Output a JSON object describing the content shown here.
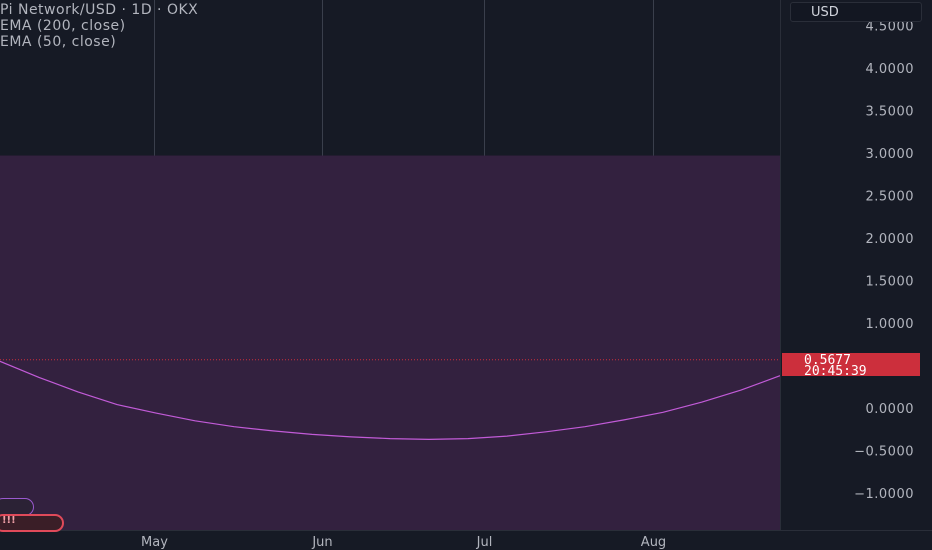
{
  "legend": {
    "symbol": "Pi Network/USD · 1D · OKX",
    "ema200": "EMA (200, close)",
    "ema50": "EMA (50, close)"
  },
  "axis": {
    "currency": "USD",
    "price_ticks": [
      {
        "value": 4.5,
        "label": "4.5000"
      },
      {
        "value": 4.0,
        "label": "4.0000"
      },
      {
        "value": 3.5,
        "label": "3.5000"
      },
      {
        "value": 3.0,
        "label": "3.0000"
      },
      {
        "value": 2.5,
        "label": "2.5000"
      },
      {
        "value": 2.0,
        "label": "2.0000"
      },
      {
        "value": 1.5,
        "label": "1.5000"
      },
      {
        "value": 1.0,
        "label": "1.0000"
      },
      {
        "value": 0.0,
        "label": "0.0000"
      },
      {
        "value": -0.5,
        "label": "−0.5000"
      },
      {
        "value": -1.0,
        "label": "−1.0000"
      }
    ],
    "time_ticks": [
      {
        "pos": 0.197,
        "label": "May"
      },
      {
        "pos": 0.413,
        "label": "Jun"
      },
      {
        "pos": 0.621,
        "label": "Jul"
      },
      {
        "pos": 0.837,
        "label": "Aug"
      }
    ]
  },
  "current": {
    "price": 0.5677,
    "price_label": "0.5677",
    "countdown": "20:45:39"
  },
  "colors": {
    "background": "#161a25",
    "grid": "#2a2e39",
    "band_fill": "#33213f",
    "ema_line": "#c25bd8",
    "price_line": "#cc2f3c"
  },
  "band": {
    "top_value": 2.97
  },
  "chart_data": {
    "type": "line",
    "title": "Pi Network/USD · 1D · OKX",
    "x_range": [
      0,
      1
    ],
    "ylim": [
      -1.2,
      4.6
    ],
    "series": [
      {
        "name": "EMA (200, close)",
        "x": [
          0.0,
          0.05,
          0.1,
          0.15,
          0.2,
          0.25,
          0.3,
          0.35,
          0.4,
          0.45,
          0.5,
          0.55,
          0.6,
          0.65,
          0.7,
          0.75,
          0.8,
          0.85,
          0.9,
          0.95,
          1.0
        ],
        "y": [
          0.55,
          0.36,
          0.19,
          0.04,
          -0.06,
          -0.15,
          -0.22,
          -0.27,
          -0.31,
          -0.34,
          -0.36,
          -0.37,
          -0.36,
          -0.33,
          -0.28,
          -0.22,
          -0.14,
          -0.05,
          0.07,
          0.21,
          0.38
        ]
      }
    ],
    "grid": true
  }
}
